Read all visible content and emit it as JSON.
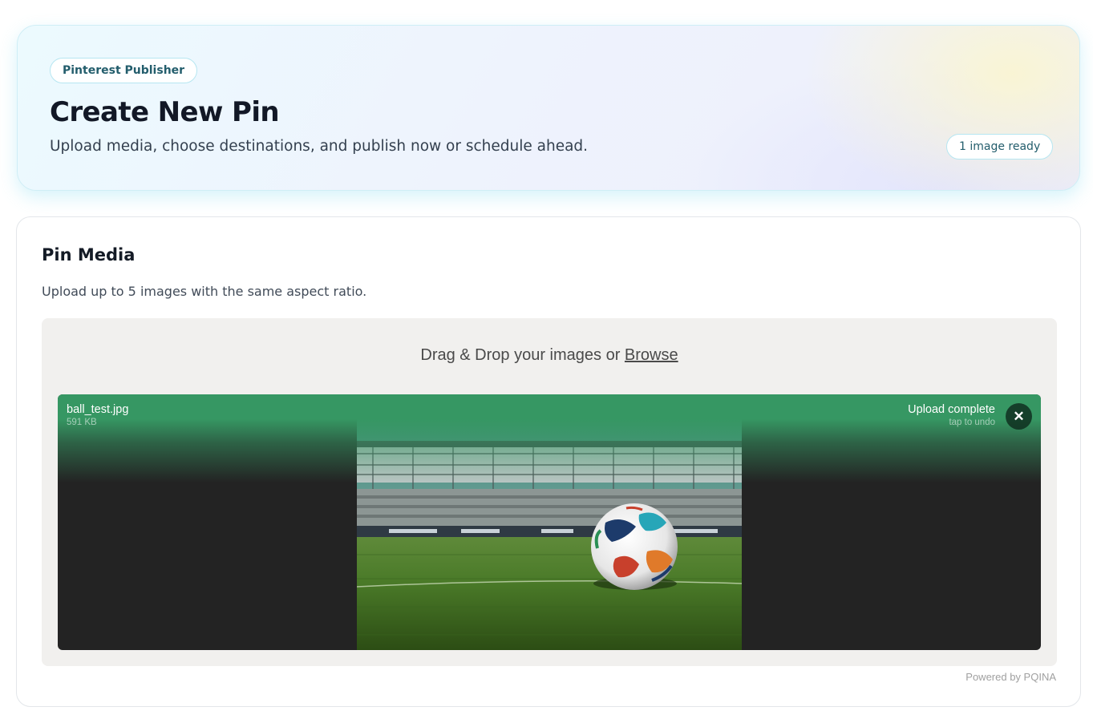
{
  "header": {
    "tag": "Pinterest Publisher",
    "title": "Create New Pin",
    "subtitle": "Upload media, choose destinations, and publish now or schedule ahead.",
    "ready_badge": "1 image ready"
  },
  "media": {
    "title": "Pin Media",
    "description": "Upload up to 5 images with the same aspect ratio.",
    "dropzone": {
      "label_prefix": "Drag & Drop your images or ",
      "browse_label": "Browse"
    },
    "file": {
      "name": "ball_test.jpg",
      "size": "591 KB",
      "status": "Upload complete",
      "status_hint": "tap to undo",
      "undo_icon": "close-icon",
      "preview_subject": "soccer ball on stadium pitch"
    },
    "credits": "Powered by PQINA"
  },
  "colors": {
    "accent_teal": "#235d6c",
    "success_green": "#369763",
    "dropzone_bg": "#f1f0ee",
    "file_bg": "#232323"
  }
}
